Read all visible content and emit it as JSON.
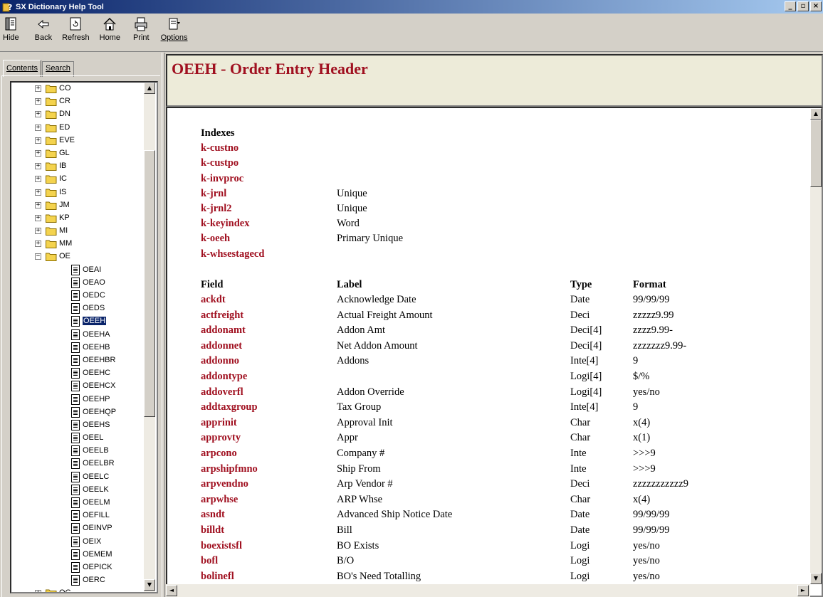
{
  "window": {
    "title": "SX Dictionary Help Tool"
  },
  "toolbar": [
    {
      "label": "Hide",
      "icon": "hide-icon"
    },
    {
      "label": "Back",
      "icon": "back-arrow-icon"
    },
    {
      "label": "Refresh",
      "icon": "refresh-icon"
    },
    {
      "label": "Home",
      "icon": "home-icon"
    },
    {
      "label": "Print",
      "icon": "printer-icon"
    },
    {
      "label": "Options",
      "icon": "options-icon"
    }
  ],
  "tabs": [
    "Contents",
    "Search"
  ],
  "tree": [
    {
      "label": "CO",
      "type": "folder",
      "state": "collapsed"
    },
    {
      "label": "CR",
      "type": "folder",
      "state": "collapsed"
    },
    {
      "label": "DN",
      "type": "folder",
      "state": "collapsed"
    },
    {
      "label": "ED",
      "type": "folder",
      "state": "collapsed"
    },
    {
      "label": "EVE",
      "type": "folder",
      "state": "collapsed"
    },
    {
      "label": "GL",
      "type": "folder",
      "state": "collapsed"
    },
    {
      "label": "IB",
      "type": "folder",
      "state": "collapsed"
    },
    {
      "label": "IC",
      "type": "folder",
      "state": "collapsed"
    },
    {
      "label": "IS",
      "type": "folder",
      "state": "collapsed"
    },
    {
      "label": "JM",
      "type": "folder",
      "state": "collapsed"
    },
    {
      "label": "KP",
      "type": "folder",
      "state": "collapsed"
    },
    {
      "label": "MI",
      "type": "folder",
      "state": "collapsed"
    },
    {
      "label": "MM",
      "type": "folder",
      "state": "collapsed"
    },
    {
      "label": "OE",
      "type": "folder",
      "state": "expanded"
    },
    {
      "label": "OEAI",
      "type": "doc"
    },
    {
      "label": "OEAO",
      "type": "doc"
    },
    {
      "label": "OEDC",
      "type": "doc"
    },
    {
      "label": "OEDS",
      "type": "doc"
    },
    {
      "label": "OEEH",
      "type": "doc",
      "selected": true
    },
    {
      "label": "OEEHA",
      "type": "doc"
    },
    {
      "label": "OEEHB",
      "type": "doc"
    },
    {
      "label": "OEEHBR",
      "type": "doc"
    },
    {
      "label": "OEEHC",
      "type": "doc"
    },
    {
      "label": "OEEHCX",
      "type": "doc"
    },
    {
      "label": "OEEHP",
      "type": "doc"
    },
    {
      "label": "OEEHQP",
      "type": "doc"
    },
    {
      "label": "OEEHS",
      "type": "doc"
    },
    {
      "label": "OEEL",
      "type": "doc"
    },
    {
      "label": "OEELB",
      "type": "doc"
    },
    {
      "label": "OEELBR",
      "type": "doc"
    },
    {
      "label": "OEELC",
      "type": "doc"
    },
    {
      "label": "OEELK",
      "type": "doc"
    },
    {
      "label": "OEELM",
      "type": "doc"
    },
    {
      "label": "OEFILL",
      "type": "doc"
    },
    {
      "label": "OEINVP",
      "type": "doc"
    },
    {
      "label": "OEIX",
      "type": "doc"
    },
    {
      "label": "OEMEM",
      "type": "doc"
    },
    {
      "label": "OEPICK",
      "type": "doc"
    },
    {
      "label": "OERC",
      "type": "doc"
    },
    {
      "label": "OG",
      "type": "folder",
      "state": "collapsed"
    }
  ],
  "page": {
    "title": "OEEH - Order Entry Header",
    "indexes_heading": "Indexes",
    "indexes": [
      {
        "name": "k-custno",
        "desc": ""
      },
      {
        "name": "k-custpo",
        "desc": ""
      },
      {
        "name": "k-invproc",
        "desc": ""
      },
      {
        "name": "k-jrnl",
        "desc": "Unique"
      },
      {
        "name": "k-jrnl2",
        "desc": "Unique"
      },
      {
        "name": "k-keyindex",
        "desc": "Word"
      },
      {
        "name": "k-oeeh",
        "desc": "Primary Unique"
      },
      {
        "name": "k-whsestagecd",
        "desc": ""
      }
    ],
    "field_headers": {
      "field": "Field",
      "label": "Label",
      "type": "Type",
      "format": "Format"
    },
    "fields": [
      {
        "field": "ackdt",
        "label": "Acknowledge Date",
        "type": "Date",
        "format": "99/99/99"
      },
      {
        "field": "actfreight",
        "label": "Actual Freight Amount",
        "type": "Deci",
        "format": "zzzzz9.99"
      },
      {
        "field": "addonamt",
        "label": "Addon Amt",
        "type": "Deci[4]",
        "format": "zzzz9.99-"
      },
      {
        "field": "addonnet",
        "label": "Net Addon Amount",
        "type": "Deci[4]",
        "format": "zzzzzzz9.99-"
      },
      {
        "field": "addonno",
        "label": "Addons",
        "type": "Inte[4]",
        "format": "9"
      },
      {
        "field": "addontype",
        "label": "",
        "type": "Logi[4]",
        "format": "$/%"
      },
      {
        "field": "addoverfl",
        "label": "Addon Override",
        "type": "Logi[4]",
        "format": "yes/no"
      },
      {
        "field": "addtaxgroup",
        "label": "Tax Group",
        "type": "Inte[4]",
        "format": "9"
      },
      {
        "field": "apprinit",
        "label": "Approval Init",
        "type": "Char",
        "format": "x(4)"
      },
      {
        "field": "approvty",
        "label": "Appr",
        "type": "Char",
        "format": "x(1)"
      },
      {
        "field": "arpcono",
        "label": "Company #",
        "type": "Inte",
        "format": ">>>9"
      },
      {
        "field": "arpshipfmno",
        "label": "Ship From",
        "type": "Inte",
        "format": ">>>9"
      },
      {
        "field": "arpvendno",
        "label": "Arp Vendor #",
        "type": "Deci",
        "format": "zzzzzzzzzzz9"
      },
      {
        "field": "arpwhse",
        "label": "ARP Whse",
        "type": "Char",
        "format": "x(4)"
      },
      {
        "field": "asndt",
        "label": "Advanced Ship Notice Date",
        "type": "Date",
        "format": "99/99/99"
      },
      {
        "field": "billdt",
        "label": "Bill",
        "type": "Date",
        "format": "99/99/99"
      },
      {
        "field": "boexistsfl",
        "label": "BO Exists",
        "type": "Logi",
        "format": "yes/no"
      },
      {
        "field": "bofl",
        "label": "B/O",
        "type": "Logi",
        "format": "yes/no"
      },
      {
        "field": "bolinefl",
        "label": "BO's Need Totalling",
        "type": "Logi",
        "format": "yes/no"
      }
    ]
  },
  "colors": {
    "accent": "#a01020",
    "header_bg": "#edebd9",
    "title_bar": "#0a246a",
    "selection": "#0a246a"
  }
}
